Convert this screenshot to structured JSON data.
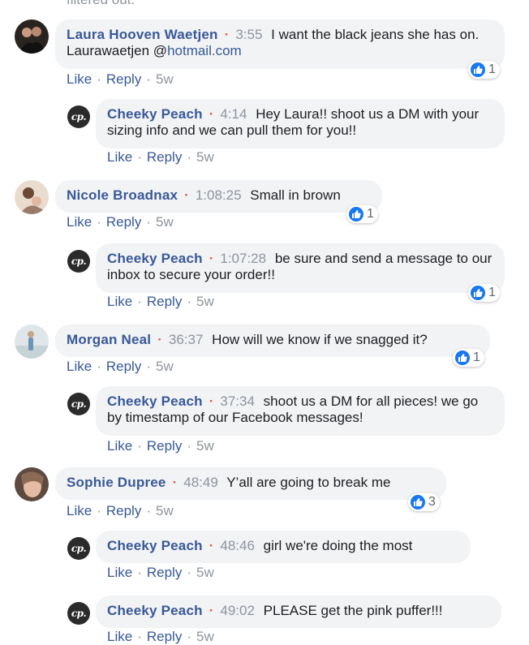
{
  "filtered_text": "filtered out.",
  "action_labels": {
    "like": "Like",
    "reply": "Reply"
  },
  "comments": [
    {
      "author": "Laura Hooven Waetjen",
      "timestamp": "3:55",
      "text": "I want the black jeans she has on. Laurawaetjen @",
      "link": "hotmail.com",
      "age": "5w",
      "reactions": "1"
    },
    {
      "author": "Cheeky Peach",
      "timestamp": "4:14",
      "text": "Hey Laura!! shoot us a DM with your sizing info and we can pull them for you!!",
      "age": "5w"
    },
    {
      "author": "Nicole Broadnax",
      "timestamp": "1:08:25",
      "text": "Small in brown",
      "age": "5w",
      "reactions": "1"
    },
    {
      "author": "Cheeky Peach",
      "timestamp": "1:07:28",
      "text": "be sure and send a message to our inbox to secure your order!!",
      "age": "5w",
      "reactions": "1"
    },
    {
      "author": "Morgan Neal",
      "timestamp": "36:37",
      "text": "How will we know if we snagged it?",
      "age": "5w",
      "reactions": "1"
    },
    {
      "author": "Cheeky Peach",
      "timestamp": "37:34",
      "text": "shoot us a DM for all pieces! we go by timestamp of our Facebook messages!",
      "age": "5w"
    },
    {
      "author": "Sophie Dupree",
      "timestamp": "48:49",
      "text": "Y’all are going to break me",
      "age": "5w",
      "reactions": "3"
    },
    {
      "author": "Cheeky Peach",
      "timestamp": "48:46",
      "text": "girl we're doing the most",
      "age": "5w"
    },
    {
      "author": "Cheeky Peach",
      "timestamp": "49:02",
      "text": "PLEASE get the pink puffer!!!",
      "age": "5w"
    }
  ],
  "page_logo_text": "cp."
}
